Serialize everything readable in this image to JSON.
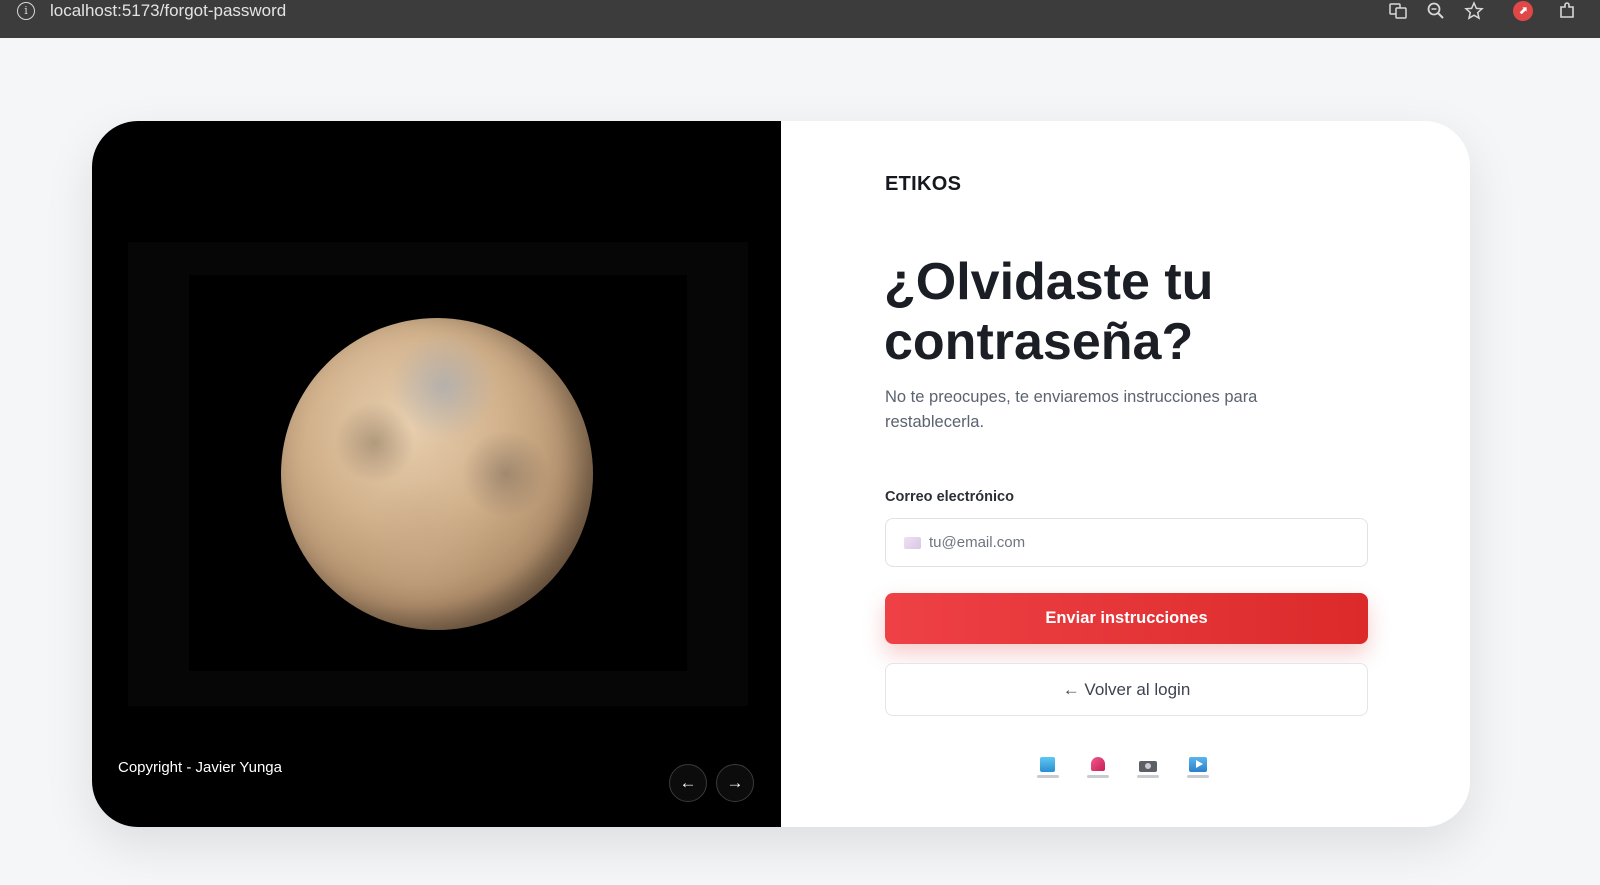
{
  "browser": {
    "url": "localhost:5173/forgot-password",
    "icons": [
      "info-icon",
      "translate-icon",
      "zoom-icon",
      "star-icon",
      "extension-red-icon",
      "extensions-puzzle-icon"
    ]
  },
  "hero": {
    "copyright": "Copyright - Javier Yunga",
    "prev_label": "←",
    "next_label": "→"
  },
  "form": {
    "brand": "ETIKOS",
    "title": "¿Olvidaste tu contraseña?",
    "subtitle": "No te preocupes, te enviaremos instrucciones para restablecerla.",
    "email_label": "Correo electrónico",
    "email_placeholder": "tu@email.com",
    "email_value": "",
    "submit_label": "Enviar instrucciones",
    "back_label": "← Volver al login"
  },
  "social": [
    "facebook-icon",
    "instagram-icon",
    "camera-icon",
    "youtube-icon"
  ],
  "colors": {
    "primary": "#e53535",
    "hero_bg": "#000000",
    "page_bg": "#f5f6f8"
  }
}
